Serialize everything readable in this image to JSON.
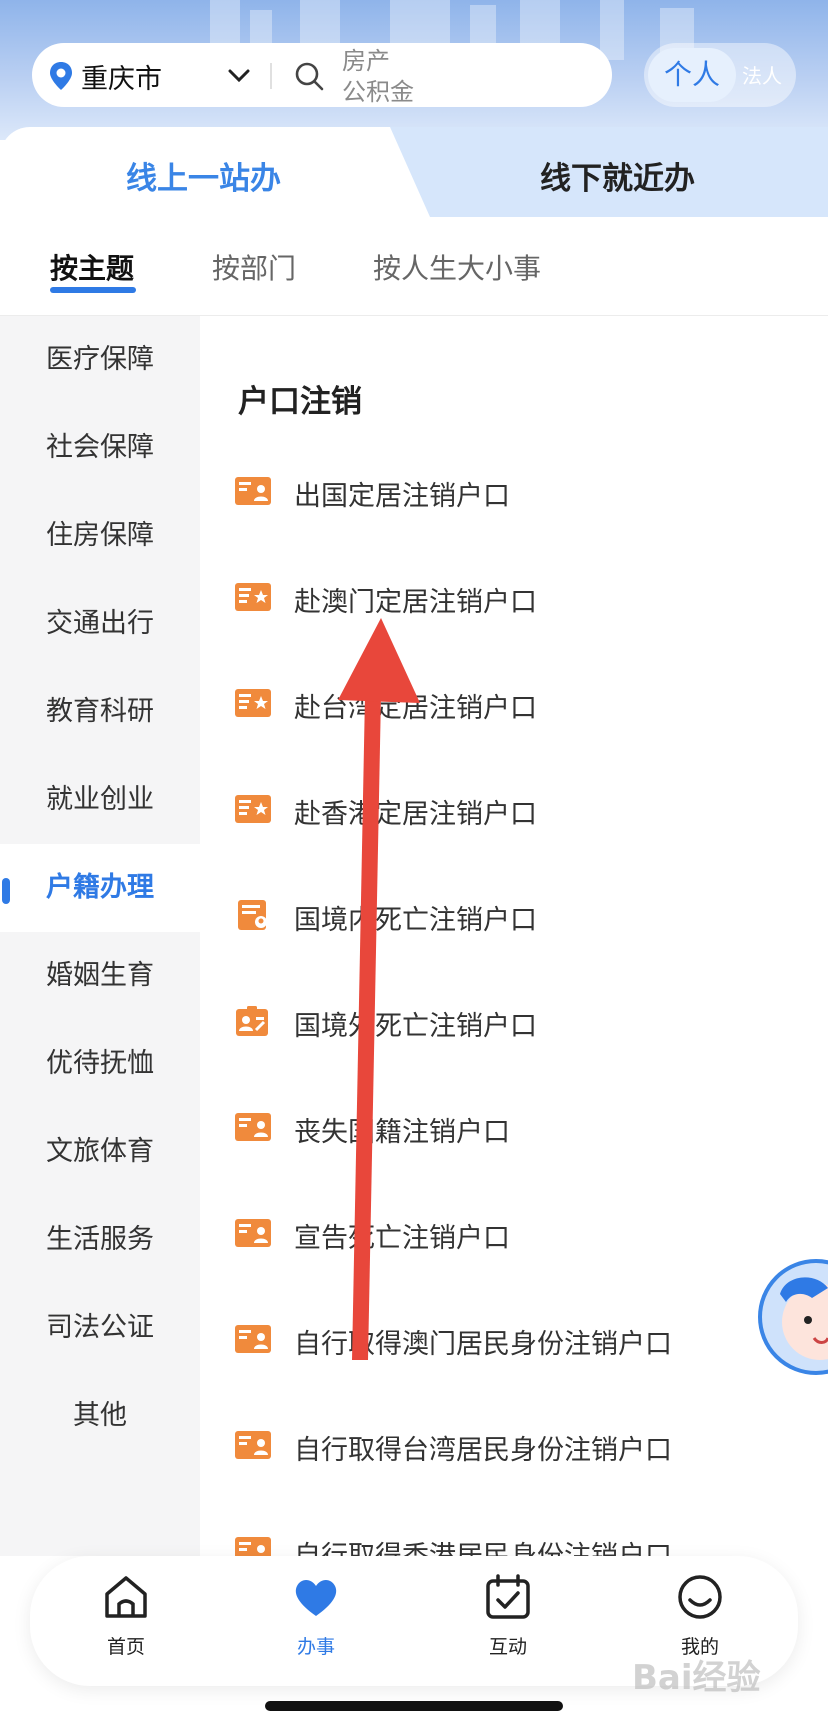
{
  "top_bar": {
    "city": "重庆市",
    "search_hints": [
      "房产",
      "公积金"
    ],
    "role_person": "个人",
    "role_legal": "法人"
  },
  "main_tabs": [
    {
      "label": "线上一站办",
      "active": true
    },
    {
      "label": "线下就近办",
      "active": false
    }
  ],
  "sub_tabs": [
    {
      "label": "按主题",
      "active": true
    },
    {
      "label": "按部门",
      "active": false
    },
    {
      "label": "按人生大小事",
      "active": false
    }
  ],
  "sidebar": {
    "items": [
      {
        "label": "医疗保障"
      },
      {
        "label": "社会保障"
      },
      {
        "label": "住房保障"
      },
      {
        "label": "交通出行"
      },
      {
        "label": "教育科研"
      },
      {
        "label": "就业创业"
      },
      {
        "label": "户籍办理",
        "active": true
      },
      {
        "label": "婚姻生育"
      },
      {
        "label": "优待抚恤"
      },
      {
        "label": "文旅体育"
      },
      {
        "label": "生活服务"
      },
      {
        "label": "司法公证"
      },
      {
        "label": "其他"
      }
    ]
  },
  "content": {
    "section_title": "户口注销",
    "items": [
      {
        "label": "出国定居注销户口",
        "icon": "id-card-icon"
      },
      {
        "label": "赴澳门定居注销户口",
        "icon": "flag-card-icon"
      },
      {
        "label": "赴台湾定居注销户口",
        "icon": "flag-card-icon"
      },
      {
        "label": "赴香港定居注销户口",
        "icon": "flag-card-icon"
      },
      {
        "label": "国境内死亡注销户口",
        "icon": "document-person-icon"
      },
      {
        "label": "国境外死亡注销户口",
        "icon": "badge-person-icon"
      },
      {
        "label": "丧失国籍注销户口",
        "icon": "id-card-icon"
      },
      {
        "label": "宣告死亡注销户口",
        "icon": "id-card-icon"
      },
      {
        "label": "自行取得澳门居民身份注销户口",
        "icon": "id-card-icon"
      },
      {
        "label": "自行取得台湾居民身份注销户口",
        "icon": "id-card-icon"
      },
      {
        "label": "自行取得香港居民身份注销户口",
        "icon": "id-card-icon"
      }
    ]
  },
  "bottom_nav": [
    {
      "label": "首页",
      "icon": "home-icon"
    },
    {
      "label": "办事",
      "icon": "heart-icon",
      "active": true
    },
    {
      "label": "互动",
      "icon": "calendar-check-icon"
    },
    {
      "label": "我的",
      "icon": "smile-icon"
    }
  ],
  "colors": {
    "accent": "#2f7ae5",
    "icon_orange": "#f08a3c",
    "arrow_red": "#e8473b"
  },
  "watermark": "Bai经验"
}
